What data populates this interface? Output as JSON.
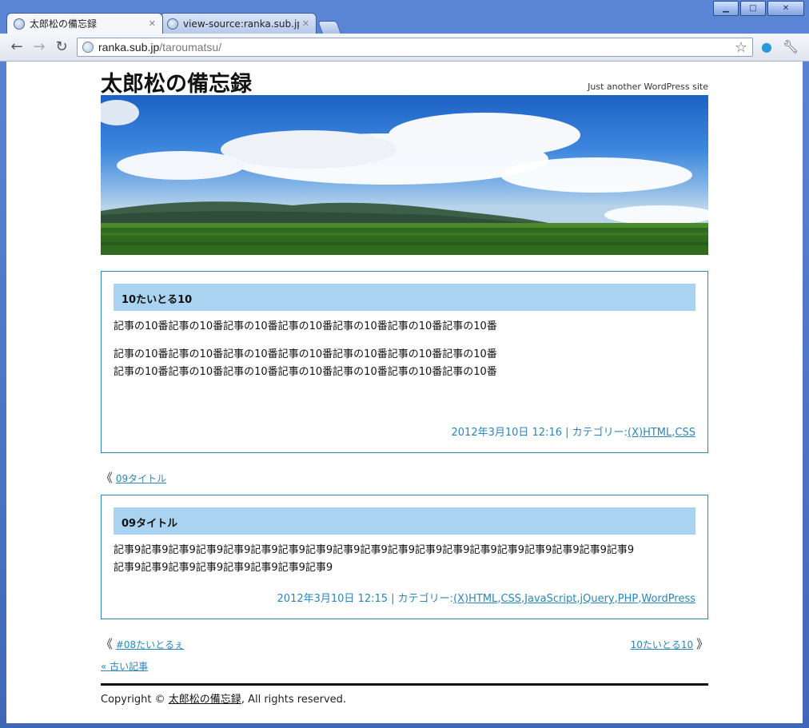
{
  "browser": {
    "tabs": [
      {
        "label": "太郎松の備忘録",
        "active": true
      },
      {
        "label": "view-source:ranka.sub.jp/tar",
        "active": false
      }
    ],
    "url_host": "ranka.sub.jp",
    "url_path": "/taroumatsu/",
    "window_buttons": {
      "minimize": "▁",
      "maximize": "□",
      "close": "✕"
    }
  },
  "site": {
    "title": "太郎松の備忘録",
    "description": "Just another WordPress site"
  },
  "posts": [
    {
      "title": "10たいとる10",
      "body_lines": [
        "記事の10番記事の10番記事の10番記事の10番記事の10番記事の10番記事の10番",
        "記事の10番記事の10番記事の10番記事の10番記事の10番記事の10番記事の10番",
        "記事の10番記事の10番記事の10番記事の10番記事の10番記事の10番記事の10番"
      ],
      "meta_date": "2012年3月10日 12:16 | カテゴリー:",
      "categories": [
        "(X)HTML",
        "CSS"
      ]
    },
    {
      "title": "09タイトル",
      "body_lines": [
        "記事9記事9記事9記事9記事9記事9記事9記事9記事9記事9記事9記事9記事9記事9記事9記事9記事9記事9記事9",
        "記事9記事9記事9記事9記事9記事9記事9記事9"
      ],
      "meta_date": "2012年3月10日 12:15 | カテゴリー:",
      "categories": [
        "(X)HTML",
        "CSS",
        "JavaScript",
        "jQuery",
        "PHP",
        "WordPress"
      ]
    }
  ],
  "nav": {
    "prev_after_first": "09タイトル",
    "prev_after_second": "#08たいとるぇ",
    "next_after_second": "10たいとる10",
    "older_posts": "« 古い記事",
    "arrow_left": "《",
    "arrow_right": "》"
  },
  "footer": {
    "prefix": "Copyright © ",
    "site_link": "太郎松の備忘録",
    "suffix": ", All rights reserved."
  },
  "colors": {
    "accent": "#2a86b8",
    "title_bar": "#a9d3f0",
    "chrome_frame": "#4a76c4"
  }
}
